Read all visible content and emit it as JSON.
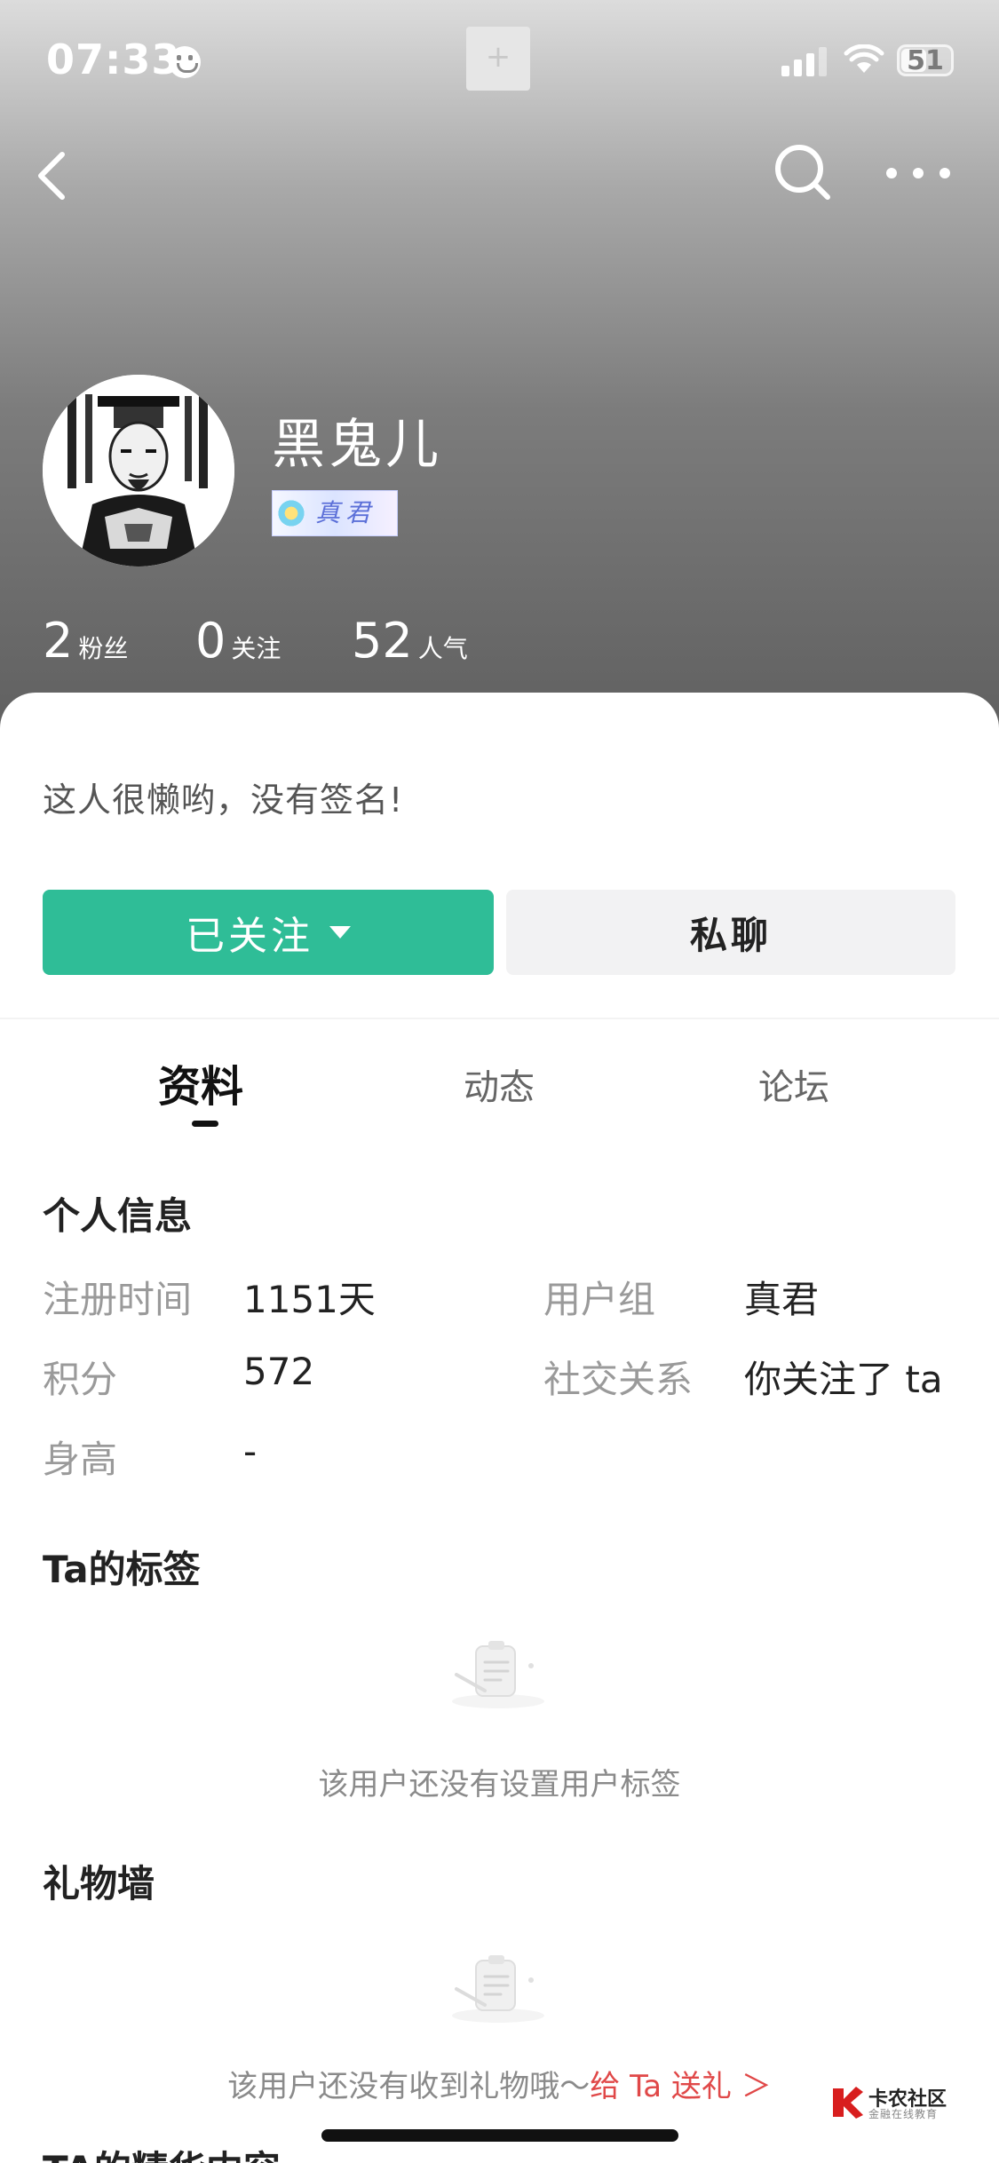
{
  "status": {
    "time": "07:33",
    "battery": "51",
    "battery_level": 0.51
  },
  "nav": {
    "back_icon": "chevron-left-icon",
    "search_icon": "search-icon",
    "more_icon": "more-horizontal-icon"
  },
  "profile": {
    "username": "黑鬼儿",
    "badge_text": "真君",
    "signature": "这人很懒哟，没有签名!"
  },
  "stats": [
    {
      "value": "2",
      "label": "粉丝"
    },
    {
      "value": "0",
      "label": "关注"
    },
    {
      "value": "52",
      "label": "人气"
    }
  ],
  "actions": {
    "follow_label": "已关注",
    "chat_label": "私聊"
  },
  "tabs": [
    {
      "label": "资料",
      "active": true
    },
    {
      "label": "动态",
      "active": false
    },
    {
      "label": "论坛",
      "active": false
    }
  ],
  "info": {
    "title": "个人信息",
    "rows": [
      {
        "label": "注册时间",
        "value": "1151天"
      },
      {
        "label": "用户组",
        "value": "真君"
      },
      {
        "label": "积分",
        "value": "572"
      },
      {
        "label": "社交关系",
        "value": "你关注了 ta"
      },
      {
        "label": "身高",
        "value": "-"
      }
    ]
  },
  "tags": {
    "title": "Ta的标签",
    "empty_text": "该用户还没有设置用户标签"
  },
  "gifts": {
    "title": "礼物墙",
    "empty_text": "该用户还没有收到礼物哦～",
    "send_link": "给 Ta 送礼 ＞"
  },
  "next_section": {
    "title": "TA的精华内容"
  },
  "watermark": {
    "name": "卡农社区",
    "sub": "金融在线教育"
  },
  "colors": {
    "accent": "#2fbd97",
    "link_red": "#e04848"
  }
}
